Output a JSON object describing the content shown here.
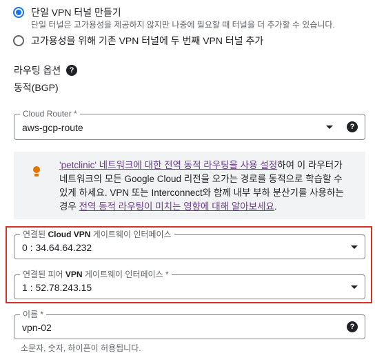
{
  "options": {
    "single_tunnel": {
      "label": "단일 VPN 터널 만들기",
      "description": "단일 터널은 고가용성을 제공하지 않지만 나중에 필요할 때 터널을 더 추가할 수 있습니다.",
      "selected": true
    },
    "second_tunnel": {
      "label": "고가용성을 위해 기존 VPN 터널에 두 번째 VPN 터널 추가",
      "selected": false
    }
  },
  "routing": {
    "label": "라우팅 옵션",
    "value": "동적(BGP)"
  },
  "cloud_router": {
    "label": "Cloud Router *",
    "value": "aws-gcp-route"
  },
  "info": {
    "link1": "'petclinic' 네트워크에 대한 전역 동적 라우팅을 사용 설정",
    "text1": "하여 이 라우터가",
    "line2": "네트워크의 모든 Google Cloud 리전을 오가는 경로를 동적으로 학습할 수",
    "line3": "있게 하세요. VPN 또는 Interconnect와 함께 내부 부하 분산기를 사용하는",
    "prefix4": "경우 ",
    "link2": "전역 동적 라우팅이 미치는 영향에 대해 알아보세요",
    "suffix4": "."
  },
  "cloud_vpn_interface": {
    "label_pre": "연결된 ",
    "label_bold": "Cloud VPN",
    "label_post": " 게이트웨이 인터페이스",
    "value": "0 : 34.64.64.232"
  },
  "peer_vpn_interface": {
    "label_pre": "연결된 피어 ",
    "label_bold": "VPN",
    "label_post": " 게이트웨이 인터페이스 *",
    "value": "1 : 52.78.243.15"
  },
  "name_field": {
    "label": "이름 *",
    "value": "vpn-02",
    "hint": "소문자, 숫자, 하이픈이 허용됩니다."
  },
  "colors": {
    "accent": "#1a73e8",
    "highlight_border": "#d93025",
    "link": "#6a3d8a",
    "bulb": "#e37400"
  }
}
